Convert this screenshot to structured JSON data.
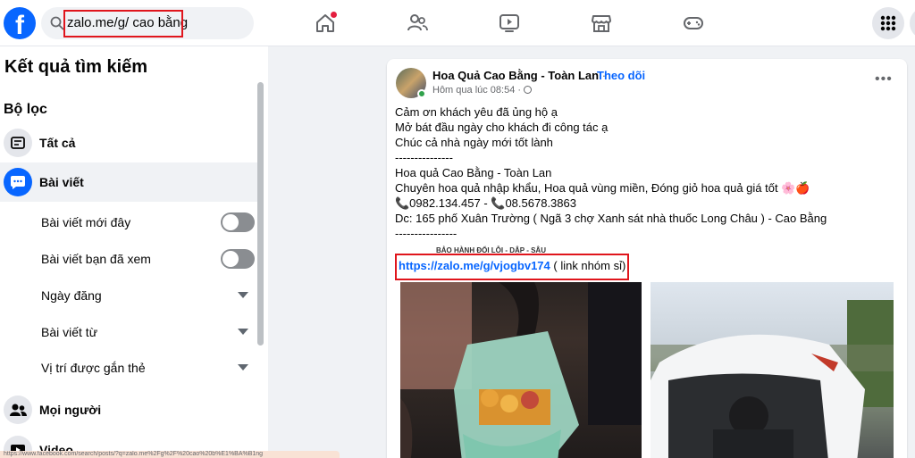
{
  "topbar": {
    "search_value": "zalo.me/g/ cao bằng",
    "nav_icons": [
      "home-icon",
      "friends-icon",
      "video-icon",
      "marketplace-icon",
      "gaming-icon"
    ],
    "accent": "#0866ff"
  },
  "left": {
    "title": "Kết quả tìm kiếm",
    "filter_heading": "Bộ lọc",
    "items": [
      {
        "label": "Tất cả",
        "icon": "feed-icon"
      },
      {
        "label": "Bài viết",
        "icon": "post-icon"
      },
      {
        "label": "Mọi người",
        "icon": "people-icon"
      },
      {
        "label": "Video",
        "icon": "video-icon"
      }
    ],
    "post_filters": [
      {
        "label": "Bài viết mới đây",
        "control": "toggle",
        "on": false
      },
      {
        "label": "Bài viết bạn đã xem",
        "control": "toggle",
        "on": false
      },
      {
        "label": "Ngày đăng",
        "control": "dropdown"
      },
      {
        "label": "Bài viết từ",
        "control": "dropdown"
      },
      {
        "label": "Vị trí được gắn thẻ",
        "control": "dropdown"
      }
    ],
    "status_url": "https://www.facebook.com/search/posts/?q=zalo.me%2Fg%2F%20cao%20b%E1%BA%B1ng"
  },
  "post": {
    "author": "Hoa Quả Cao Bằng - Toàn Lan",
    "separator": "·",
    "follow": "Theo dõi",
    "time": "Hôm qua lúc 08:54 ·",
    "lines": [
      "Cảm ơn khách yêu đã ủng hộ ạ",
      "Mở bát đầu ngày cho khách đi công tác ạ",
      "Chúc cả nhà ngày mới tốt lành",
      "---------------",
      "Hoa quả Cao Bằng - Toàn Lan",
      "Chuyên hoa quả nhập khẩu, Hoa quả vùng miền, Đóng giỏ hoa quả giá tốt 🌸🍎",
      "📞0982.134.457 - 📞08.5678.3863",
      "Dc: 165 phố Xuân Trường ( Ngã 3 chợ Xanh sát nhà thuốc Long Châu ) -  Cao Bằng",
      "----------------"
    ],
    "small_note": "BẢO HÀNH ĐỔI LỖI - DẬP - SÂU",
    "link": "https://zalo.me/g/vjogbv174",
    "link_suffix": " ( link nhóm sỉ)"
  }
}
